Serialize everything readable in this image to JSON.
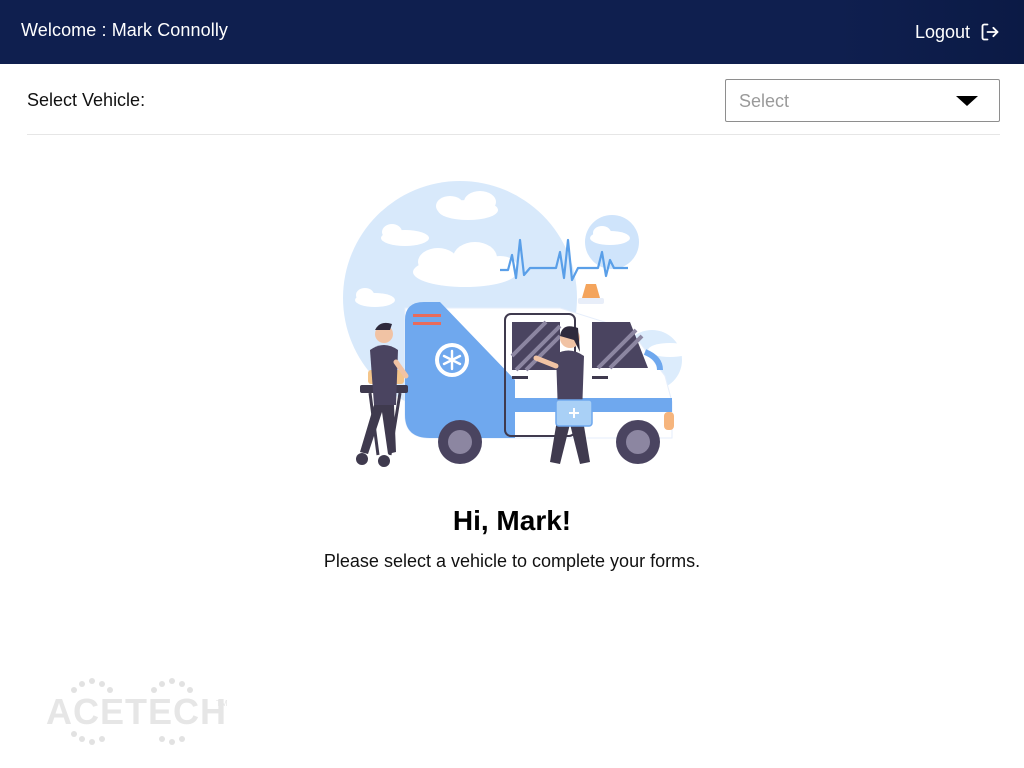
{
  "header": {
    "welcome_text": "Welcome : Mark Connolly",
    "logout_label": "Logout",
    "logout_icon": "logout-icon",
    "background_color": "#0f1f4f"
  },
  "vehicle": {
    "label": "Select Vehicle:",
    "select_placeholder": "Select",
    "dropdown_icon": "caret-down-icon"
  },
  "main": {
    "illustration": "ambulance-paramedics-illustration",
    "greeting": "Hi, Mark!",
    "instruction": "Please select a vehicle to complete your forms."
  },
  "footer": {
    "logo_text": "ACETECH",
    "logo_mark": "TM"
  }
}
